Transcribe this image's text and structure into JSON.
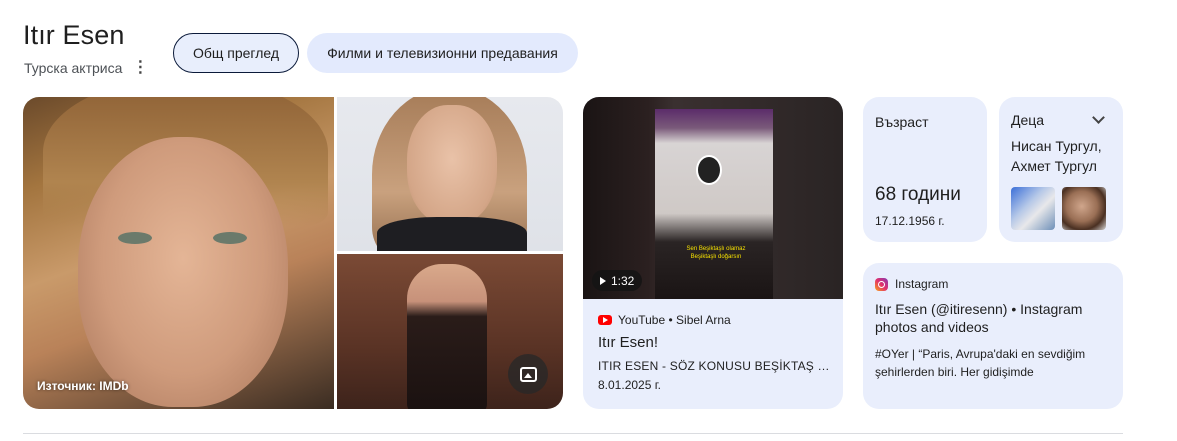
{
  "header": {
    "title": "Itır Esen",
    "subtitle": "Турска актриса",
    "more_icon": "more-vert-icon"
  },
  "chips": {
    "overview": "Общ преглед",
    "films": "Филми и телевизионни предавания"
  },
  "photos": {
    "source_label": "Източник: IMDb",
    "images_icon": "image-icon"
  },
  "video": {
    "duration": "1:32",
    "source": "YouTube • Sibel Arna",
    "title": "Itır Esen!",
    "description": "ITIR ESEN - SÖZ KONUSU BEŞİKTAŞ OLUNCA",
    "date": "8.01.2025 г.",
    "thumbnail_caption": "Sen Beşiktaşlı olamaz Beşiktaşlı doğarsın"
  },
  "age": {
    "label": "Възраст",
    "value": "68 години",
    "birth_date": "17.12.1956 г."
  },
  "children": {
    "label": "Деца",
    "names": [
      "Нисан Тургул,",
      "Ахмет Тургул"
    ]
  },
  "instagram": {
    "source": "Instagram",
    "title": "Itır Esen (@itiresenn) • Instagram photos and videos",
    "description": "#OYer | “Paris, Avrupa'daki en sevdiğim şehirlerden biri. Her gidişimde sosyokültürel…"
  },
  "colors": {
    "card_bg": "#e9eefc",
    "chip_bg": "#e3eafd",
    "youtube_red": "#ff0000"
  }
}
